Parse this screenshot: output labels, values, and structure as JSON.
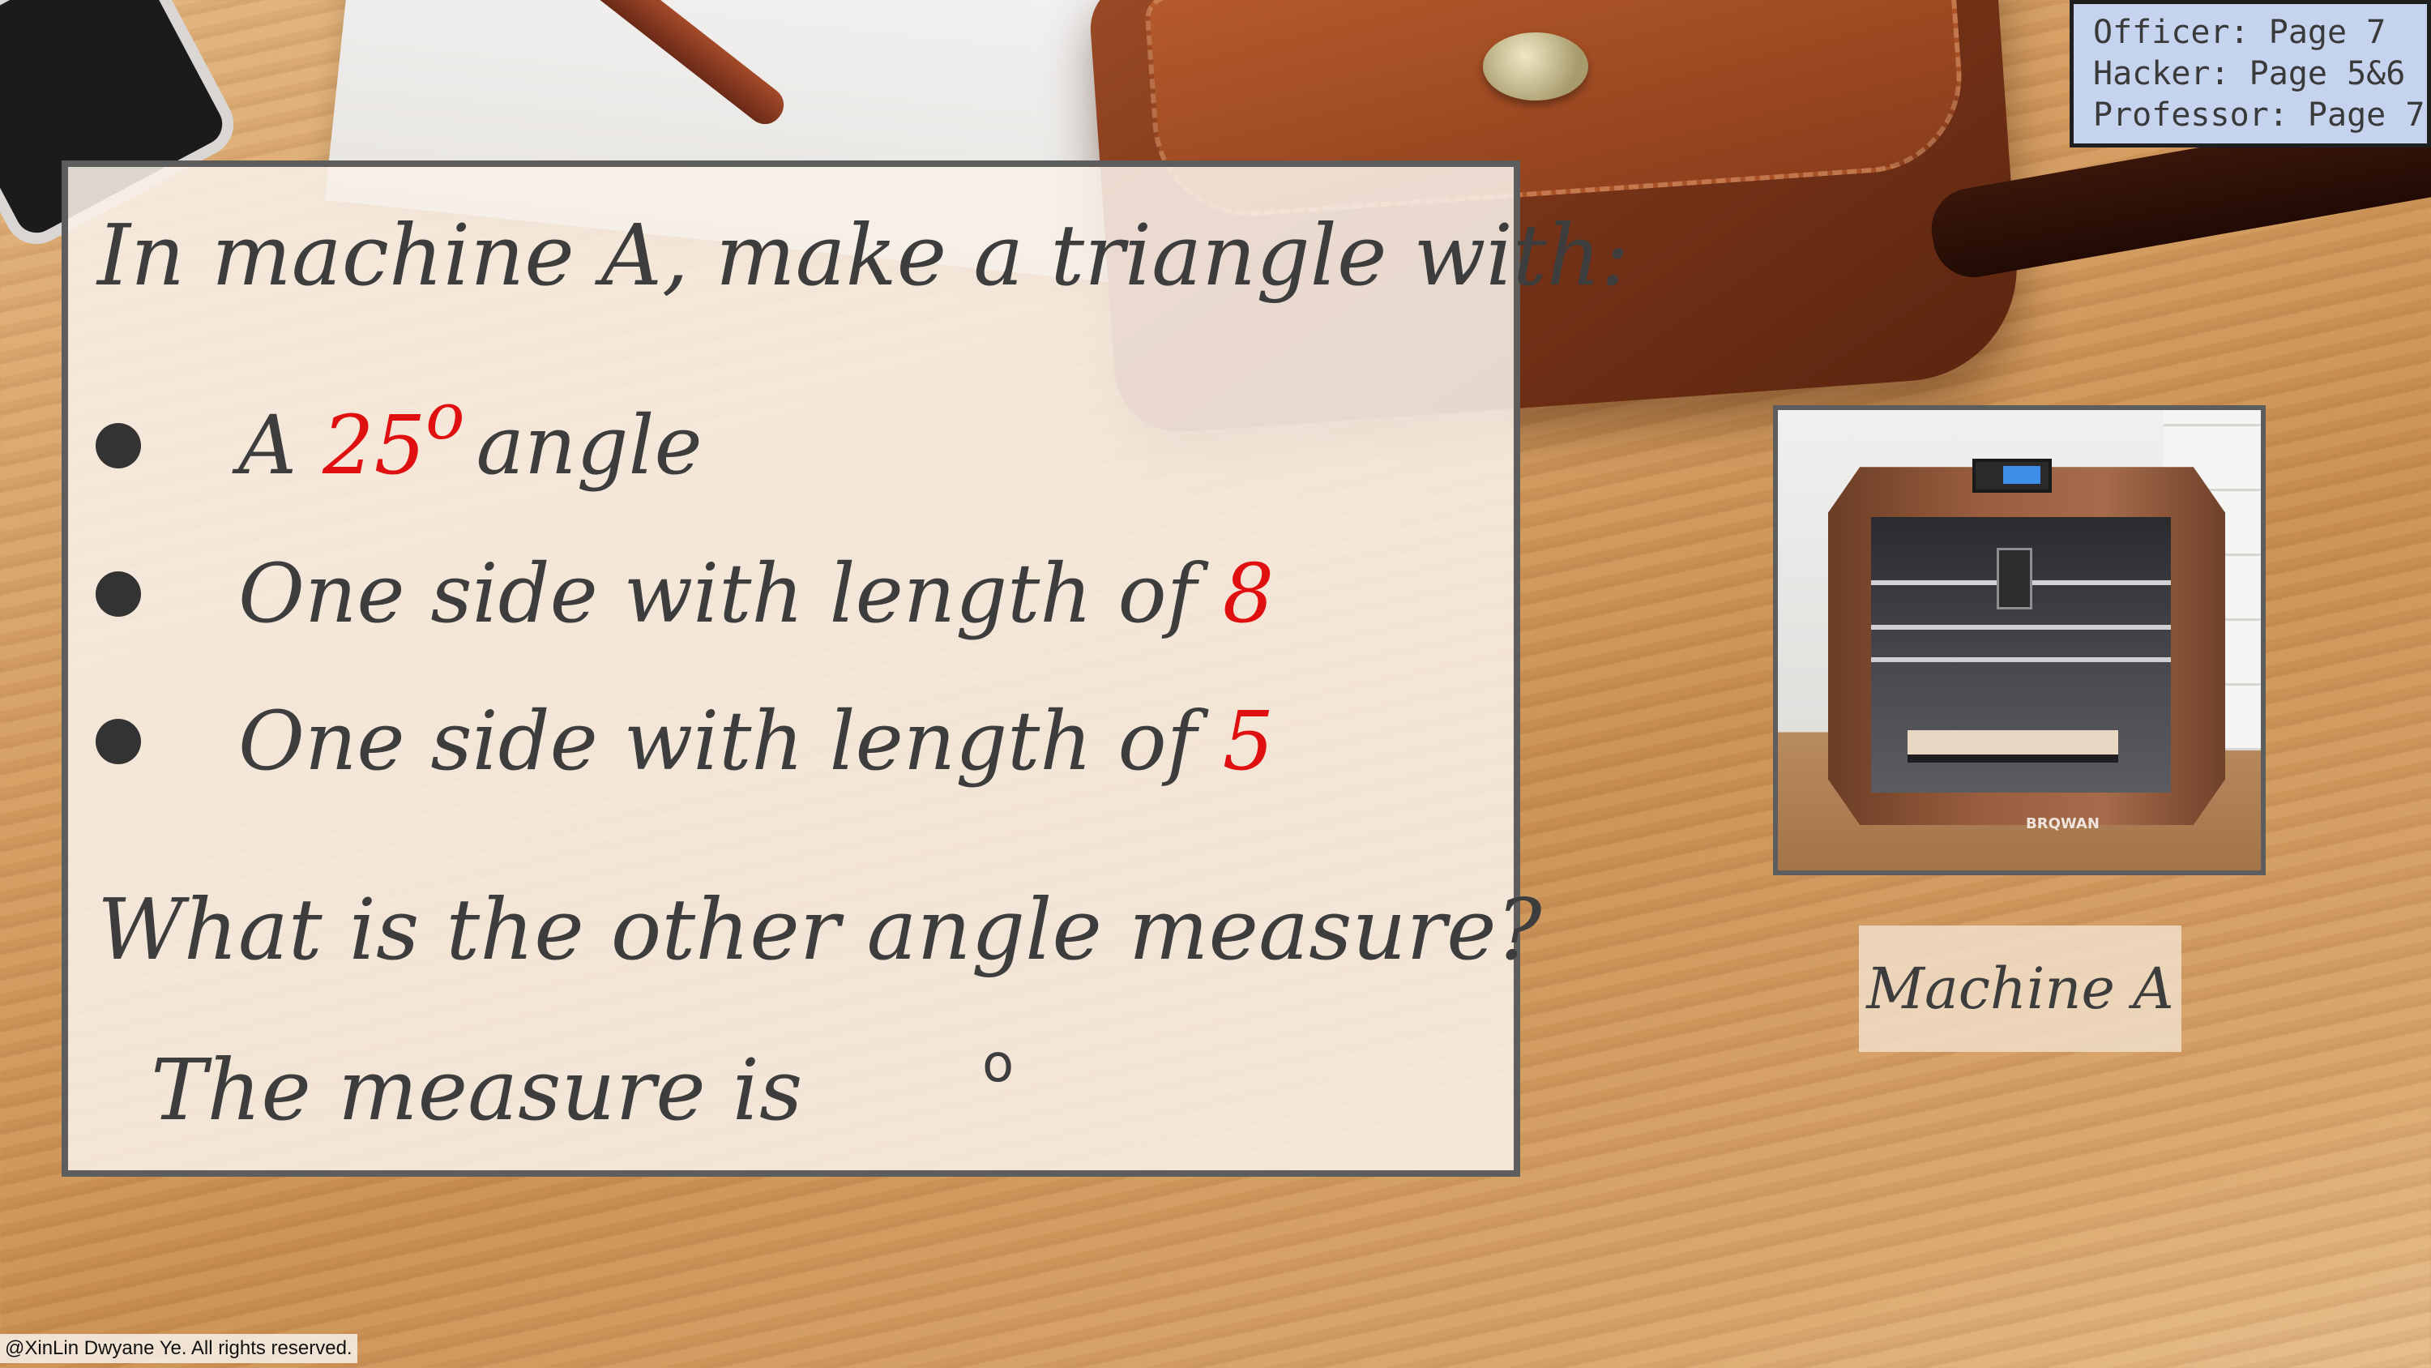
{
  "card": {
    "title": "In machine A, make a triangle with:",
    "bullets": [
      {
        "prefix": "A ",
        "value": "25",
        "degree": "o",
        "suffix": "angle"
      },
      {
        "prefix": "One side with length of ",
        "value": "8"
      },
      {
        "prefix": "One side with length of ",
        "value": "5"
      }
    ],
    "question": "What is the other angle measure?",
    "answer_prefix": "The measure is",
    "answer_degree": "o"
  },
  "roles": [
    "Officer: Page 7",
    "Hacker: Page 5&6",
    "Professor: Page 7"
  ],
  "machine": {
    "label": "Machine A",
    "brand": "BRQWAN",
    "icon": "3d-printer-image"
  },
  "footer": {
    "copyright": "@XinLin Dwyane Ye. All rights reserved."
  },
  "colors": {
    "highlight": "#e01010",
    "info_box": "#c5d3ef",
    "card_border": "#5d5d5d"
  }
}
